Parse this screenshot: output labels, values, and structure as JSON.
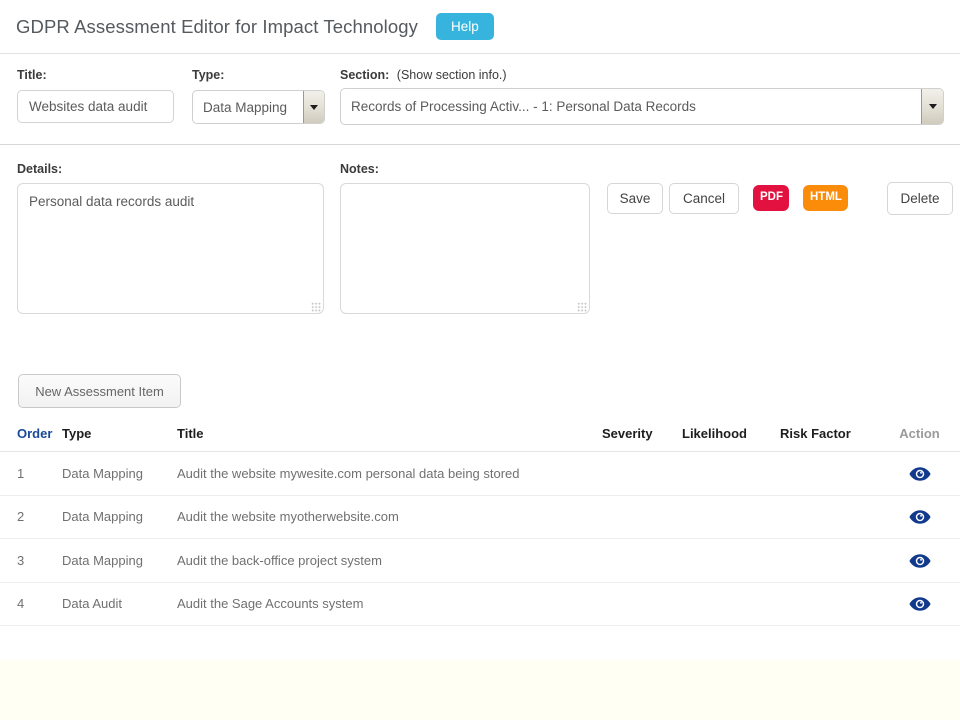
{
  "header": {
    "title": "GDPR Assessment Editor for Impact Technology",
    "help_label": "Help"
  },
  "form": {
    "title_label": "Title:",
    "title_value": "Websites data audit",
    "type_label": "Type:",
    "type_value": "Data Mapping",
    "section_label": "Section:",
    "section_hint": "(Show section info.)",
    "section_value": "Records of Processing Activ... - 1: Personal Data Records",
    "details_label": "Details:",
    "details_value": "Personal data records audit",
    "notes_label": "Notes:",
    "notes_value": ""
  },
  "actions": {
    "save_label": "Save",
    "cancel_label": "Cancel",
    "pdf_label": "PDF",
    "html_label": "HTML",
    "delete_label": "Delete",
    "new_item_label": "New Assessment Item"
  },
  "table": {
    "columns": [
      "Order",
      "Type",
      "Title",
      "Severity",
      "Likelihood",
      "Risk Factor",
      "Action"
    ],
    "rows": [
      {
        "order": "1",
        "type": "Data Mapping",
        "title": "Audit the website mywesite.com personal data being stored",
        "severity": "",
        "likelihood": "",
        "risk_factor": "",
        "action_icon": "eye-icon"
      },
      {
        "order": "2",
        "type": "Data Mapping",
        "title": "Audit the website myotherwebsite.com",
        "severity": "",
        "likelihood": "",
        "risk_factor": "",
        "action_icon": "eye-icon"
      },
      {
        "order": "3",
        "type": "Data Mapping",
        "title": "Audit the back-office project system",
        "severity": "",
        "likelihood": "",
        "risk_factor": "",
        "action_icon": "eye-icon"
      },
      {
        "order": "4",
        "type": "Data Audit",
        "title": "Audit the Sage Accounts system",
        "severity": "",
        "likelihood": "",
        "risk_factor": "",
        "action_icon": "eye-icon"
      }
    ]
  },
  "colors": {
    "help_button": "#36b4dd",
    "pdf_button": "#e2113f",
    "html_button": "#fb8c0a",
    "order_header": "#194a97",
    "eye_icon": "#123a8c",
    "bottom_band": "#fffff4"
  }
}
